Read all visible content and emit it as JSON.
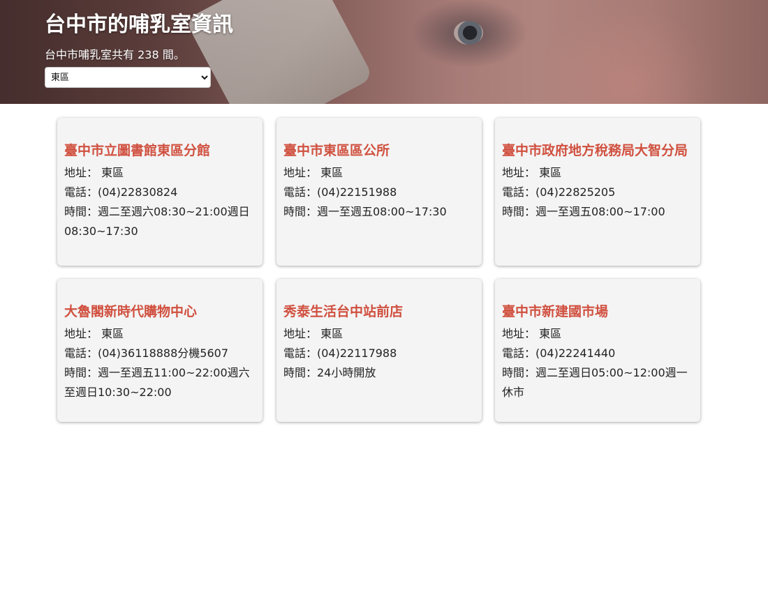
{
  "header": {
    "title": "台中市的哺乳室資訊",
    "count_text": "台中市哺乳室共有 238 間。",
    "district_selected": "東區"
  },
  "cards": [
    {
      "name": "臺中市立圖書館東區分館",
      "address": "地址： 東區",
      "phone": "電話：(04)22830824",
      "hours": "時間：週二至週六08:30~21:00週日08:30~17:30"
    },
    {
      "name": "臺中市東區區公所",
      "address": "地址： 東區",
      "phone": "電話：(04)22151988",
      "hours": "時間：週一至週五08:00~17:30"
    },
    {
      "name": "臺中市政府地方稅務局大智分局",
      "address": "地址： 東區",
      "phone": "電話：(04)22825205",
      "hours": "時間：週一至週五08:00~17:00"
    },
    {
      "name": "大魯閣新時代購物中心",
      "address": "地址： 東區",
      "phone": "電話：(04)36118888分機5607",
      "hours": "時間：週一至週五11:00~22:00週六至週日10:30~22:00"
    },
    {
      "name": "秀泰生活台中站前店",
      "address": "地址： 東區",
      "phone": "電話：(04)22117988",
      "hours": "時間：24小時開放"
    },
    {
      "name": "臺中市新建國市場",
      "address": "地址： 東區",
      "phone": "電話：(04)22241440",
      "hours": "時間：週二至週日05:00~12:00週一休市"
    }
  ]
}
